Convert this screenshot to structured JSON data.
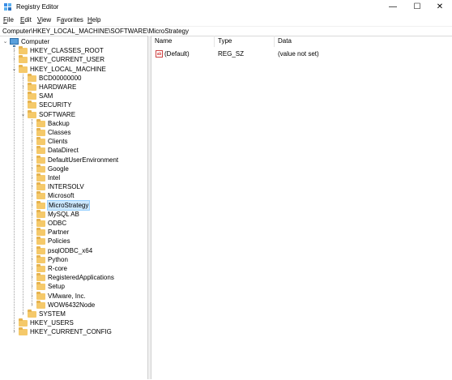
{
  "window": {
    "title": "Registry Editor",
    "min_symbol": "—",
    "max_symbol": "☐",
    "close_symbol": "✕"
  },
  "menu": [
    {
      "label_prefix": "",
      "accel": "F",
      "label_rest": "ile"
    },
    {
      "label_prefix": "",
      "accel": "E",
      "label_rest": "dit"
    },
    {
      "label_prefix": "",
      "accel": "V",
      "label_rest": "iew"
    },
    {
      "label_prefix": "F",
      "accel": "a",
      "label_rest": "vorites"
    },
    {
      "label_prefix": "",
      "accel": "H",
      "label_rest": "elp"
    }
  ],
  "address": "Computer\\HKEY_LOCAL_MACHINE\\SOFTWARE\\MicroStrategy",
  "tree": {
    "root": "Computer",
    "hives": [
      "HKEY_CLASSES_ROOT",
      "HKEY_CURRENT_USER",
      "HKEY_LOCAL_MACHINE"
    ],
    "hklm_children": [
      "BCD00000000",
      "HARDWARE",
      "SAM",
      "SECURITY",
      "SOFTWARE"
    ],
    "software_children": [
      "Backup",
      "Classes",
      "Clients",
      "DataDirect",
      "DefaultUserEnvironment",
      "Google",
      "Intel",
      "INTERSOLV",
      "Microsoft",
      "MicroStrategy",
      "MySQL AB",
      "ODBC",
      "Partner",
      "Policies",
      "psqlODBC_x64",
      "Python",
      "R-core",
      "RegisteredApplications",
      "Setup",
      "VMware, Inc.",
      "WOW6432Node"
    ],
    "after_software": [
      "SYSTEM"
    ],
    "bottom_hives": [
      "HKEY_USERS",
      "HKEY_CURRENT_CONFIG"
    ],
    "selected": "MicroStrategy"
  },
  "list": {
    "columns": [
      "Name",
      "Type",
      "Data"
    ],
    "rows": [
      {
        "icon": "ab",
        "name": "(Default)",
        "type": "REG_SZ",
        "data": "(value not set)"
      }
    ]
  }
}
